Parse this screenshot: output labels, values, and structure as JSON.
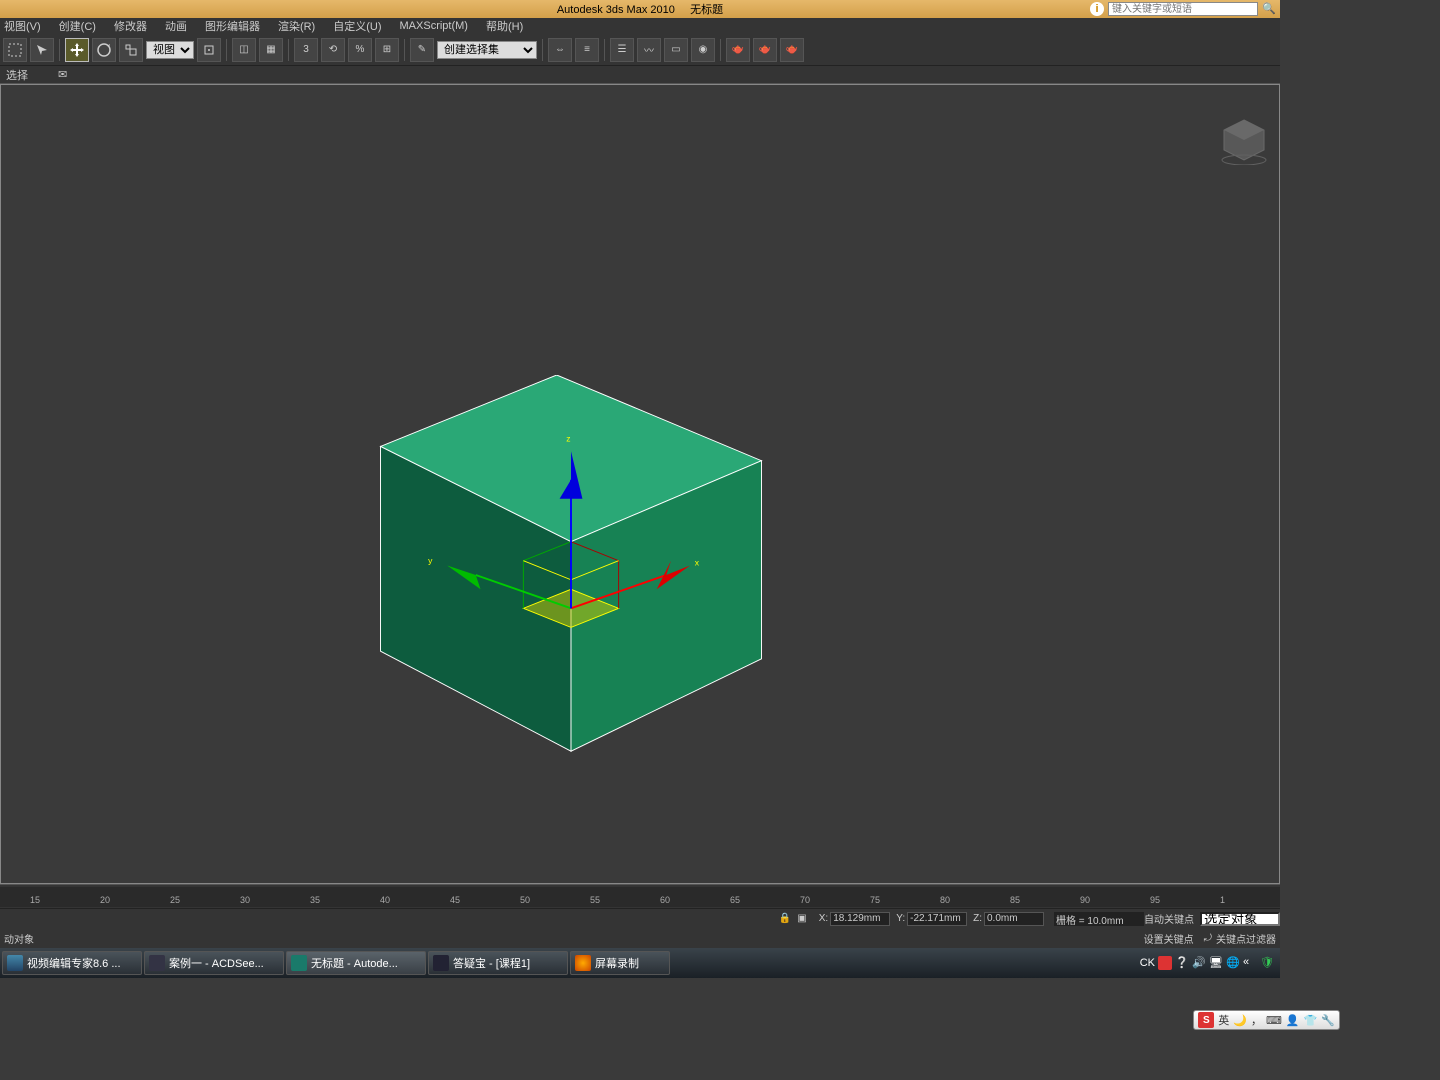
{
  "title": {
    "app": "Autodesk 3ds Max  2010",
    "doc": "无标题",
    "search_placeholder": "键入关键字或短语"
  },
  "menu": {
    "view": "视图(V)",
    "create": "创建(C)",
    "modifier": "修改器",
    "anim": "动画",
    "graph": "图形编辑器",
    "render": "渲染(R)",
    "custom": "自定义(U)",
    "maxscript": "MAXScript(M)",
    "help": "帮助(H)"
  },
  "toolbar": {
    "ref_dropdown": "视图",
    "select_set": "创建选择集"
  },
  "subbar": {
    "select_label": "选择"
  },
  "gizmo": {
    "x": "x",
    "y": "y",
    "z": "z"
  },
  "timeline": {
    "ticks": [
      "15",
      "20",
      "25",
      "30",
      "35",
      "40",
      "45",
      "50",
      "55",
      "60",
      "65",
      "70",
      "75",
      "80",
      "85",
      "90",
      "95",
      "1"
    ]
  },
  "status": {
    "x_label": "X:",
    "x_val": "18.129mm",
    "y_label": "Y:",
    "y_val": "-22.171mm",
    "z_label": "Z:",
    "z_val": "0.0mm",
    "grid": "栅格 = 10.0mm",
    "autokey": "自动关键点",
    "sel_obj": "选定对象",
    "set_key": "设置关键点",
    "key_filter": "关键点过滤器",
    "prompt_left": "动对象"
  },
  "ime": {
    "engine": "英"
  },
  "taskbar": {
    "items": [
      "视频编辑专家8.6 ...",
      "案例一 - ACDSee...",
      "无标题 - Autode...",
      "答疑宝 - [课程1]",
      "屏幕录制"
    ],
    "tray_ck": "CK"
  }
}
